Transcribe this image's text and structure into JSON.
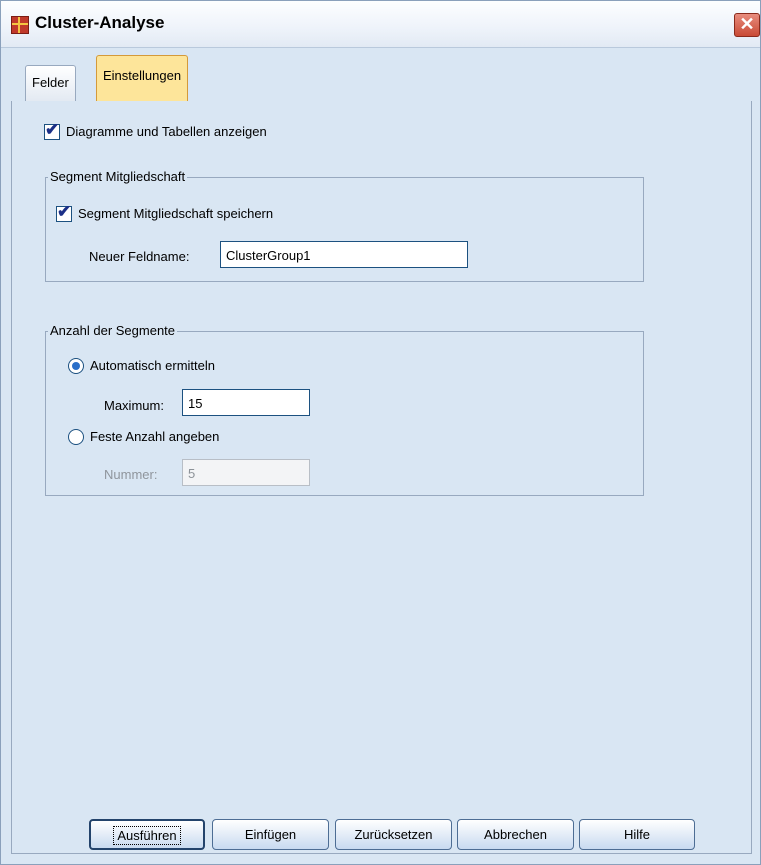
{
  "window": {
    "title": "Cluster-Analyse",
    "close_icon": "close-icon"
  },
  "tabs": [
    {
      "label": "Felder",
      "active": false
    },
    {
      "label": "Einstellungen",
      "active": true
    }
  ],
  "settings": {
    "show_charts": {
      "label": "Diagramme und Tabellen anzeigen",
      "checked": true
    },
    "membership": {
      "group_label": "Segment Mitgliedschaft",
      "save": {
        "label": "Segment Mitgliedschaft speichern",
        "checked": true
      },
      "field_name_label": "Neuer Feldname:",
      "field_name_value": "ClusterGroup1"
    },
    "segments": {
      "group_label": "Anzahl der Segmente",
      "auto": {
        "label": "Automatisch ermitteln",
        "selected": true
      },
      "maximum_label": "Maximum:",
      "maximum_value": "15",
      "fixed": {
        "label": "Feste Anzahl angeben",
        "selected": false
      },
      "number_label": "Nummer:",
      "number_value": "5"
    }
  },
  "buttons": {
    "run": "Ausführen",
    "paste": "Einfügen",
    "reset": "Zurücksetzen",
    "cancel": "Abbrechen",
    "help": "Hilfe"
  },
  "colors": {
    "active_tab": "#fde59a",
    "panel": "#d9e6f3",
    "close": "#c94a35"
  }
}
